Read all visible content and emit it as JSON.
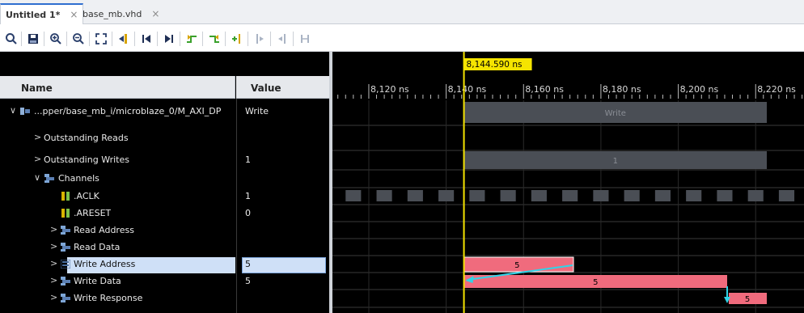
{
  "tabs": [
    {
      "label": "Untitled 1*",
      "active": true
    },
    {
      "label": "base_mb.vhd",
      "active": false
    }
  ],
  "toolbar": {
    "icons": [
      "search-icon",
      "save-icon",
      "zoom-in-icon",
      "zoom-out-icon",
      "zoom-fit-icon",
      "go-to-cursor-icon",
      "go-to-start-icon",
      "go-to-end-icon",
      "previous-transition-icon",
      "next-transition-icon",
      "add-marker-icon",
      "previous-marker-icon",
      "next-marker-icon",
      "swap-cursors-icon"
    ]
  },
  "columns": {
    "name": "Name",
    "value": "Value"
  },
  "signals": [
    {
      "name": "...pper/base_mb_i/microblaze_0/M_AXI_DP",
      "value": "Write",
      "expander": "∨",
      "icon": "bus-interface-icon"
    },
    {
      "name": "Outstanding Reads",
      "value": "",
      "expander": ">",
      "icon": ""
    },
    {
      "name": "Outstanding Writes",
      "value": "1",
      "expander": ">",
      "icon": ""
    },
    {
      "name": "Channels",
      "value": "",
      "expander": "∨",
      "icon": "channel-group-icon"
    },
    {
      "name": ".ACLK",
      "value": "1",
      "expander": "",
      "icon": "logic-signal-icon"
    },
    {
      "name": ".ARESET",
      "value": "0",
      "expander": "",
      "icon": "logic-signal-icon"
    },
    {
      "name": "Read Address",
      "value": "",
      "expander": ">",
      "icon": "channel-icon"
    },
    {
      "name": "Read Data",
      "value": "",
      "expander": ">",
      "icon": "channel-icon"
    },
    {
      "name": "Write Address",
      "value": "5",
      "expander": ">",
      "icon": "channel-selected-icon",
      "selected": true
    },
    {
      "name": "Write Data",
      "value": "5",
      "expander": ">",
      "icon": "channel-icon"
    },
    {
      "name": "Write Response",
      "value": "",
      "expander": ">",
      "icon": "channel-icon"
    }
  ],
  "cursor": {
    "label": "8,144.590 ns",
    "time_ns": 8144.59,
    "color": "#f5e400"
  },
  "timeline": {
    "start_ns": 8110.6,
    "end_ns": 8232.5,
    "ticks": [
      {
        "label": "8,120 ns",
        "t": 8120
      },
      {
        "label": "8,140 ns",
        "t": 8140
      },
      {
        "label": "8,160 ns",
        "t": 8160
      },
      {
        "label": "8,180 ns",
        "t": 8180
      },
      {
        "label": "8,200 ns",
        "t": 8200
      },
      {
        "label": "8,220 ns",
        "t": 8220
      }
    ]
  },
  "waves": {
    "transaction_label": "Write",
    "outstanding_writes_label": "1",
    "write_address_label": "5",
    "write_data_label": "5",
    "write_response_label": "5",
    "colors": {
      "bus": "#4a4e55",
      "clock": "#4a4e55",
      "transaction": "#f06b7d",
      "arrow": "#2fd4e8",
      "grid": "#3a3a3a"
    }
  }
}
